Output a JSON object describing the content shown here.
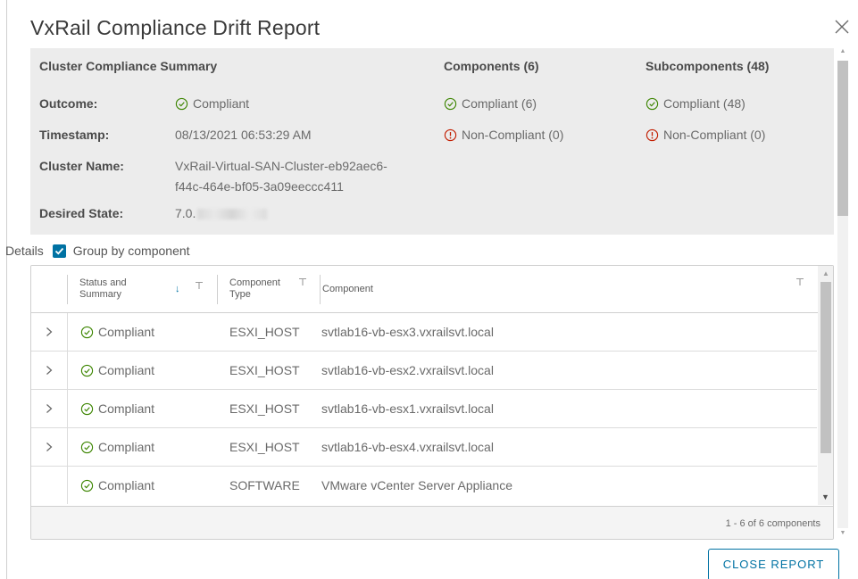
{
  "dialog": {
    "title": "VxRail Compliance Drift Report",
    "close_icon": "close-icon",
    "close_button_label": "CLOSE REPORT"
  },
  "summary": {
    "heading": "Cluster Compliance Summary",
    "components_heading": "Components (6)",
    "subcomponents_heading": "Subcomponents (48)",
    "outcome_label": "Outcome:",
    "outcome_value": "Compliant",
    "timestamp_label": "Timestamp:",
    "timestamp_value": "08/13/2021 06:53:29 AM",
    "cluster_name_label": "Cluster Name:",
    "cluster_name_line1": "VxRail-Virtual-SAN-Cluster-eb92aec6-",
    "cluster_name_line2": "f44c-464e-bf05-3a09eeccc411",
    "desired_state_label": "Desired State:",
    "desired_state_value": "7.0.",
    "components_compliant": "Compliant (6)",
    "components_noncompliant": "Non-Compliant (0)",
    "subcomponents_compliant": "Compliant (48)",
    "subcomponents_noncompliant": "Non-Compliant (0)"
  },
  "details": {
    "label": "Details",
    "group_by_label": "Group by component",
    "group_by_checked": true
  },
  "grid": {
    "columns": {
      "status_line1": "Status and",
      "status_line2": "Summary",
      "type_line1": "Component",
      "type_line2": "Type",
      "component": "Component"
    },
    "rows": [
      {
        "status": "Compliant",
        "type": "ESXI_HOST",
        "component": "svtlab16-vb-esx3.vxrailsvt.local",
        "expandable": true
      },
      {
        "status": "Compliant",
        "type": "ESXI_HOST",
        "component": "svtlab16-vb-esx2.vxrailsvt.local",
        "expandable": true
      },
      {
        "status": "Compliant",
        "type": "ESXI_HOST",
        "component": "svtlab16-vb-esx1.vxrailsvt.local",
        "expandable": true
      },
      {
        "status": "Compliant",
        "type": "ESXI_HOST",
        "component": "svtlab16-vb-esx4.vxrailsvt.local",
        "expandable": true
      },
      {
        "status": "Compliant",
        "type": "SOFTWARE",
        "component": "VMware vCenter Server Appliance",
        "expandable": false
      }
    ],
    "pagination": "1 - 6 of 6 components"
  },
  "colors": {
    "ok_green": "#3c8500",
    "error_red": "#c21d00",
    "accent_blue": "#0072a3",
    "summary_bg": "#ececec"
  }
}
